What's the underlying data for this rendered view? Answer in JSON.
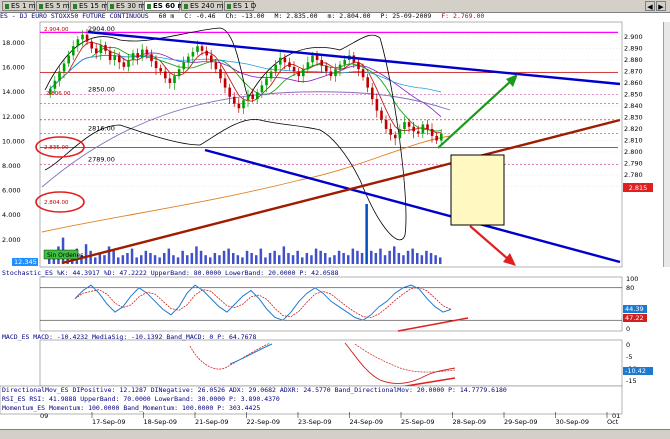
{
  "tabs": [
    {
      "label": "ES 1 m",
      "active": false
    },
    {
      "label": "ES 5 m",
      "active": false
    },
    {
      "label": "ES 15 m",
      "active": false
    },
    {
      "label": "ES 30 m",
      "active": false
    },
    {
      "label": "ES 60 m",
      "active": true
    },
    {
      "label": "ES 240 m",
      "active": false
    },
    {
      "label": "ES 1 D",
      "active": false
    }
  ],
  "info": {
    "symbol": "ES - DJ EURO STOXX50 FUTURE CONTINUOUS",
    "interval": "60 m",
    "last": "C: -0.46",
    "change": "Ch: -13.00",
    "high": "M: 2.835.00",
    "low": "m: 2.804.00",
    "date": "P: 25-09-2009",
    "close": "F: 2.769.00"
  },
  "price_axis": [
    "2.900",
    "2.890",
    "2.880",
    "2.870",
    "2.860",
    "2.850",
    "2.840",
    "2.830",
    "2.820",
    "2.810",
    "2.800",
    "2.790",
    "2.780",
    "2.770"
  ],
  "current_price": "2.815",
  "volume_axis": [
    "18.000",
    "16.000",
    "14.000",
    "12.000",
    "10.000",
    "8.000",
    "6.000",
    "4.000",
    "2.000"
  ],
  "price_labels": {
    "high": "2904.00",
    "high_box": "2.904.00",
    "l2850": "2850.00",
    "l2816": "2816.00",
    "l2789": "2789.00",
    "left_red1": "2.806.00",
    "left_red2": "2.835.00",
    "left_red3": "2.804.00",
    "vol_badge": "12.345"
  },
  "signals_label": "Sin Ordenes",
  "stochastic": {
    "label": "Stochastic_ES %K: 44.3917  %D: 47.2222  UpperBand: 80.0000  LowerBand: 20.0000  P: 42.0588",
    "axis": [
      "100",
      "80",
      "20",
      "0"
    ],
    "current_k": "44.39",
    "current_d": "47.22"
  },
  "macd": {
    "label": "MACD_ES MACD: -10.4232  MediaSig: -10.1392  Band_MACD: 0  P: 64.7678",
    "axis": [
      "0",
      "-5",
      "-10",
      "-15"
    ],
    "current": "-10.42"
  },
  "dmi": {
    "label": "DirectionalMov_ES DIPositive: 12.1287  DINegative: 26.0526  ADX: 29.0682  ADXR: 24.5770  Band_DirectionalMov: 20.0000  P: 14.7779.6180"
  },
  "rsi": {
    "label": "RSI_ES RSI: 41.9888  UpperBand: 70.0000  LowerBand: 30.0000  P: 3.890.4370"
  },
  "momentum": {
    "label": "Momentum_ES Momentum: 100.0000  Band_Momentum: 100.0000  P: 303.4425"
  },
  "dates": [
    "17-Sep-09",
    "18-Sep-09",
    "21-Sep-09",
    "22-Sep-09",
    "23-Sep-09",
    "24-Sep-09",
    "25-Sep-09",
    "28-Sep-09",
    "29-Sep-09",
    "30-Sep-09",
    "Oct"
  ],
  "date_year": "09",
  "date_year2": "01",
  "colors": {
    "candle_up": "#00a000",
    "candle_down": "#c00000",
    "trend_blue": "#0000cc",
    "trend_brown": "#a01c00",
    "magenta": "#ff00ff",
    "projection_box": "#fff8c0"
  }
}
